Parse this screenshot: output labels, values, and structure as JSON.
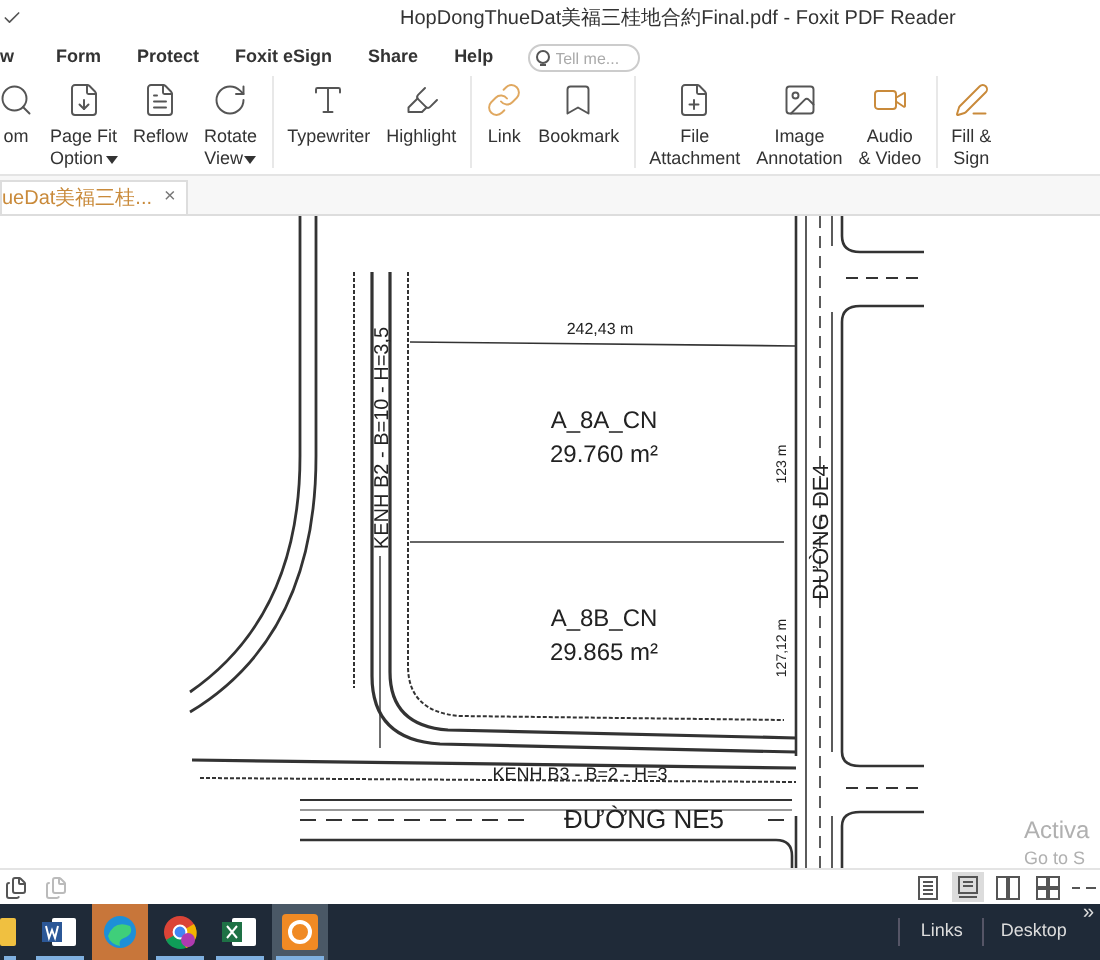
{
  "window": {
    "title": "HopDongThueDat美福三桂地合約Final.pdf - Foxit PDF Reader"
  },
  "menu": [
    "w",
    "Form",
    "Protect",
    "Foxit eSign",
    "Share",
    "Help"
  ],
  "search": {
    "placeholder": "Tell me..."
  },
  "ribbon": [
    [
      {
        "kind": "zoom",
        "lines": [
          "om"
        ],
        "dropdown": false
      },
      {
        "kind": "pagefit",
        "lines": [
          "Page Fit",
          "Option"
        ],
        "dropdown": true
      },
      {
        "kind": "reflow",
        "lines": [
          "Reflow"
        ],
        "dropdown": false
      },
      {
        "kind": "rotate",
        "lines": [
          "Rotate",
          "View"
        ],
        "dropdown": true
      }
    ],
    [
      {
        "kind": "typewriter",
        "lines": [
          "Typewriter"
        ],
        "dropdown": false
      },
      {
        "kind": "highlight",
        "lines": [
          "Highlight"
        ],
        "dropdown": false
      }
    ],
    [
      {
        "kind": "link",
        "lines": [
          "Link"
        ],
        "dropdown": false
      },
      {
        "kind": "bookmark",
        "lines": [
          "Bookmark"
        ],
        "dropdown": false
      }
    ],
    [
      {
        "kind": "file",
        "lines": [
          "File",
          "Attachment"
        ],
        "dropdown": false
      },
      {
        "kind": "image",
        "lines": [
          "Image",
          "Annotation"
        ],
        "dropdown": false
      },
      {
        "kind": "video",
        "lines": [
          "Audio",
          "& Video"
        ],
        "dropdown": false
      }
    ],
    [
      {
        "kind": "sign",
        "lines": [
          "Fill &",
          "Sign"
        ],
        "dropdown": false
      }
    ]
  ],
  "tabs": [
    {
      "label": "ueDat美福三桂...",
      "selected": true,
      "close": "×"
    }
  ],
  "drawing": {
    "top_width": "242,43 m",
    "lots": [
      {
        "name": "A_8A_CN",
        "area": "29.760 m²",
        "side": "123 m"
      },
      {
        "name": "A_8B_CN",
        "area": "29.865 m²",
        "side": "127,12 m"
      }
    ],
    "canal_left": "KENH B2 - B=10 - H=3,5",
    "canal_bottom": "KENH B3 - B=2 - H=3",
    "road_right": "ĐƯỜNG DE4",
    "road_bottom": "ĐƯỜNG NE5"
  },
  "activation": [
    "Activa",
    "Go to S"
  ],
  "status_bar": {
    "view_modes": [
      {
        "kind": "single",
        "selected": false
      },
      {
        "kind": "continuous",
        "selected": true
      },
      {
        "kind": "facing",
        "selected": false
      },
      {
        "kind": "cover",
        "selected": false
      }
    ]
  },
  "taskbar": {
    "apps": [
      {
        "kind": "files",
        "active": false,
        "flashing": false
      },
      {
        "kind": "word",
        "active": false,
        "flashing": false
      },
      {
        "kind": "edge",
        "active": false,
        "flashing": true
      },
      {
        "kind": "chrome",
        "active": false,
        "flashing": false
      },
      {
        "kind": "excel",
        "active": false,
        "flashing": false
      },
      {
        "kind": "foxit",
        "active": true,
        "flashing": false
      }
    ],
    "links": "Links",
    "desktop": "Desktop",
    "more": "»"
  }
}
